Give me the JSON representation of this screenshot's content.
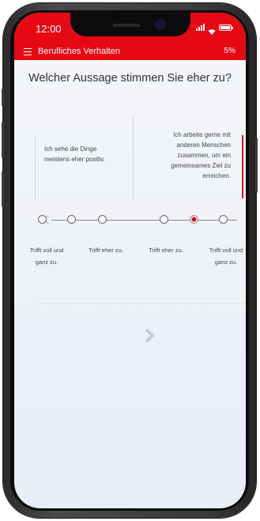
{
  "status_bar": {
    "time": "12:00"
  },
  "app_bar": {
    "title": "Berufliches Verhalten",
    "progress": "5%"
  },
  "question": "Welcher Aussage stimmen Sie eher zu?",
  "statements": {
    "left": "Ich sehe die Dinge meistens eher positiv.",
    "right": "Ich arbeite gerne mit anderen Menschen zusammen, um ein gemeinsames Ziel zu erreichen."
  },
  "scale": {
    "options": 6,
    "selected_index": 4,
    "labels": [
      "Trifft voll und ganz zu.",
      "Trifft eher zu.",
      "Trifft eher zu.",
      "Trifft voll und ganz zu."
    ]
  },
  "colors": {
    "accent": "#e60914",
    "background": "#f4f6fa"
  },
  "icons": [
    "menu-icon",
    "signal-icon",
    "wifi-icon",
    "battery-icon",
    "chevron-left-icon",
    "chevron-right-icon",
    "next-arrow-icon"
  ]
}
